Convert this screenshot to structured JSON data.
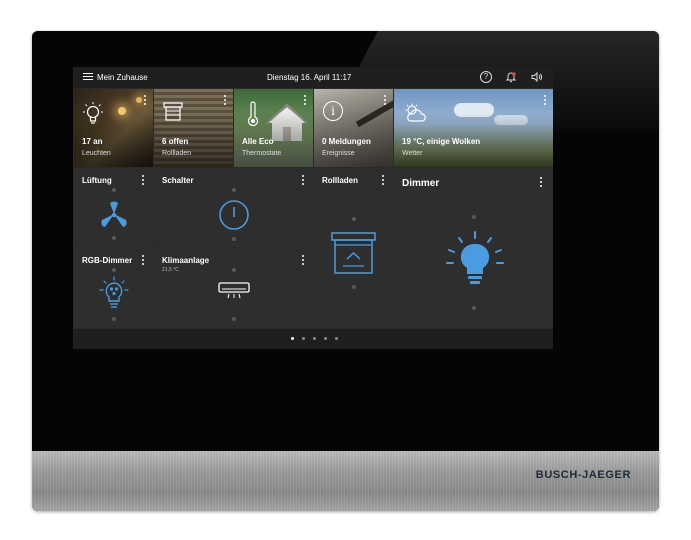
{
  "brand": "BUSCH-JAEGER",
  "topbar": {
    "title": "Mein Zuhause",
    "datetime": "Dienstag 16. April  11:17",
    "help_glyph": "?"
  },
  "status_tiles": [
    {
      "title": "17 an",
      "subtitle": "Leuchten"
    },
    {
      "title": "6 offen",
      "subtitle": "Rollladen"
    },
    {
      "title": "Alle Eco",
      "subtitle": "Thermostate"
    },
    {
      "title": "0 Meldungen",
      "subtitle": "Ereignisse",
      "icon_glyph": "i"
    },
    {
      "title": "19 °C, einige Wolken",
      "subtitle": "Wetter"
    }
  ],
  "control_tiles": {
    "lueftung": {
      "title": "Lüftung"
    },
    "schalter": {
      "title": "Schalter"
    },
    "rollladen": {
      "title": "Rollladen"
    },
    "dimmer": {
      "title": "Dimmer"
    },
    "rgb": {
      "title": "RGB-Dimmer"
    },
    "klima": {
      "title": "Klimaanlage",
      "temp": "21,5 °C"
    }
  },
  "pager": {
    "pages": 5,
    "active": 1
  },
  "colors": {
    "accent": "#4a9be0",
    "screen_bg": "#2a2a2a",
    "tile_bg": "#2e2e2e",
    "bell": "#e0463c"
  },
  "icons": [
    "menu-icon",
    "help-icon",
    "bell-icon",
    "speaker-icon",
    "bulb-icon",
    "blind-icon",
    "thermometer-icon",
    "info-icon",
    "weather-icon",
    "fan-icon",
    "power-icon",
    "shutter-icon",
    "rgb-bulb-icon",
    "ac-icon",
    "dimmer-bulb-icon"
  ]
}
